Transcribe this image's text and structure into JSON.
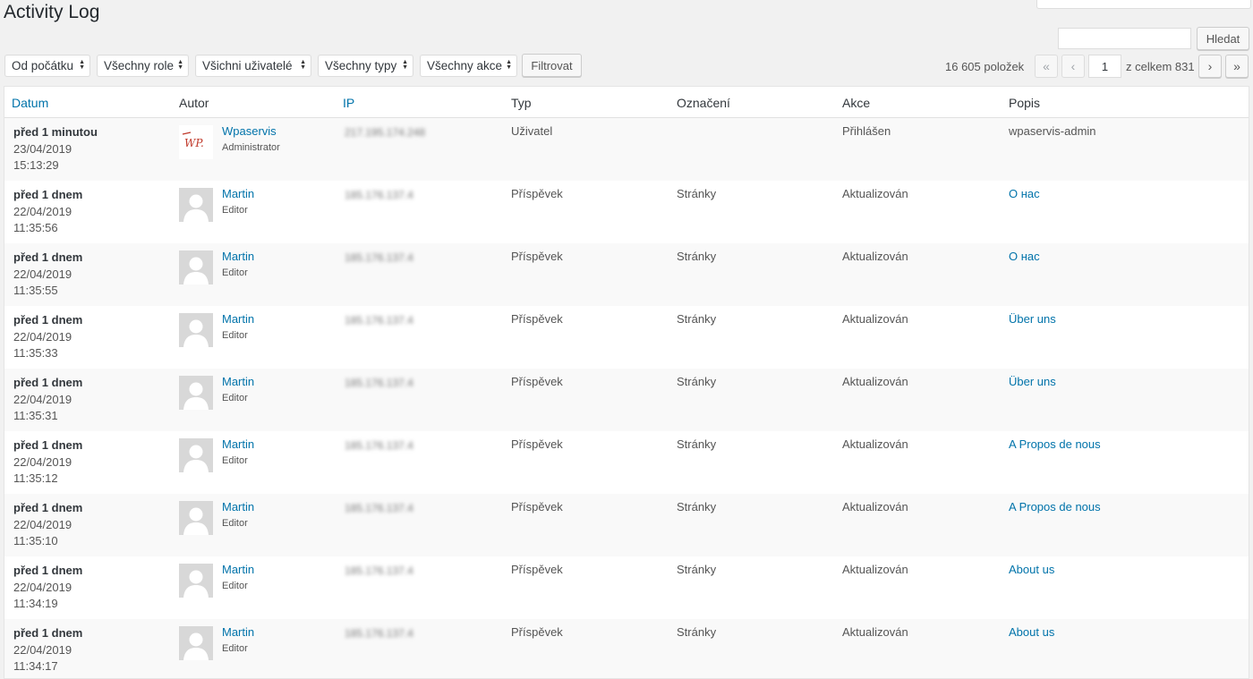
{
  "page": {
    "title": "Activity Log"
  },
  "search": {
    "value": "",
    "button_label": "Hledat"
  },
  "filters": [
    {
      "label": "Od počátku"
    },
    {
      "label": "Všechny role"
    },
    {
      "label": "Všichni uživatelé"
    },
    {
      "label": "Všechny typy"
    },
    {
      "label": "Všechny akce"
    }
  ],
  "filter_button_label": "Filtrovat",
  "pagination": {
    "items_count": "16 605 položek",
    "first": "«",
    "prev": "‹",
    "current_page": "1",
    "total_text": "z celkem 831",
    "next": "›",
    "last": "»"
  },
  "table": {
    "columns": [
      "Datum",
      "Autor",
      "IP",
      "Typ",
      "Označení",
      "Akce",
      "Popis"
    ],
    "rows": [
      {
        "relative": "před 1 minutou",
        "date": "23/04/2019",
        "time": "15:13:29",
        "author": "Wpaservis",
        "role": "Administrator",
        "ip": "217.195.174.248",
        "type": "Uživatel",
        "label": "",
        "action": "Přihlášen",
        "description": "wpaservis-admin",
        "desc_link": false,
        "logo": true
      },
      {
        "relative": "před 1 dnem",
        "date": "22/04/2019",
        "time": "11:35:56",
        "author": "Martin",
        "role": "Editor",
        "ip": "185.176.137.4",
        "type": "Příspěvek",
        "label": "Stránky",
        "action": "Aktualizován",
        "description": "О нас",
        "desc_link": true,
        "logo": false
      },
      {
        "relative": "před 1 dnem",
        "date": "22/04/2019",
        "time": "11:35:55",
        "author": "Martin",
        "role": "Editor",
        "ip": "185.176.137.4",
        "type": "Příspěvek",
        "label": "Stránky",
        "action": "Aktualizován",
        "description": "О нас",
        "desc_link": true,
        "logo": false
      },
      {
        "relative": "před 1 dnem",
        "date": "22/04/2019",
        "time": "11:35:33",
        "author": "Martin",
        "role": "Editor",
        "ip": "185.176.137.4",
        "type": "Příspěvek",
        "label": "Stránky",
        "action": "Aktualizován",
        "description": "Über uns",
        "desc_link": true,
        "logo": false
      },
      {
        "relative": "před 1 dnem",
        "date": "22/04/2019",
        "time": "11:35:31",
        "author": "Martin",
        "role": "Editor",
        "ip": "185.176.137.4",
        "type": "Příspěvek",
        "label": "Stránky",
        "action": "Aktualizován",
        "description": "Über uns",
        "desc_link": true,
        "logo": false
      },
      {
        "relative": "před 1 dnem",
        "date": "22/04/2019",
        "time": "11:35:12",
        "author": "Martin",
        "role": "Editor",
        "ip": "185.176.137.4",
        "type": "Příspěvek",
        "label": "Stránky",
        "action": "Aktualizován",
        "description": "A Propos de nous",
        "desc_link": true,
        "logo": false
      },
      {
        "relative": "před 1 dnem",
        "date": "22/04/2019",
        "time": "11:35:10",
        "author": "Martin",
        "role": "Editor",
        "ip": "185.176.137.4",
        "type": "Příspěvek",
        "label": "Stránky",
        "action": "Aktualizován",
        "description": "A Propos de nous",
        "desc_link": true,
        "logo": false
      },
      {
        "relative": "před 1 dnem",
        "date": "22/04/2019",
        "time": "11:34:19",
        "author": "Martin",
        "role": "Editor",
        "ip": "185.176.137.4",
        "type": "Příspěvek",
        "label": "Stránky",
        "action": "Aktualizován",
        "description": "About us",
        "desc_link": true,
        "logo": false
      },
      {
        "relative": "před 1 dnem",
        "date": "22/04/2019",
        "time": "11:34:17",
        "author": "Martin",
        "role": "Editor",
        "ip": "185.176.137.4",
        "type": "Příspěvek",
        "label": "Stránky",
        "action": "Aktualizován",
        "description": "About us",
        "desc_link": true,
        "logo": false
      }
    ]
  },
  "logo_text": "WP.",
  "colors": {
    "link": "#0073aa",
    "text": "#555555",
    "background": "#f1f1f1"
  }
}
